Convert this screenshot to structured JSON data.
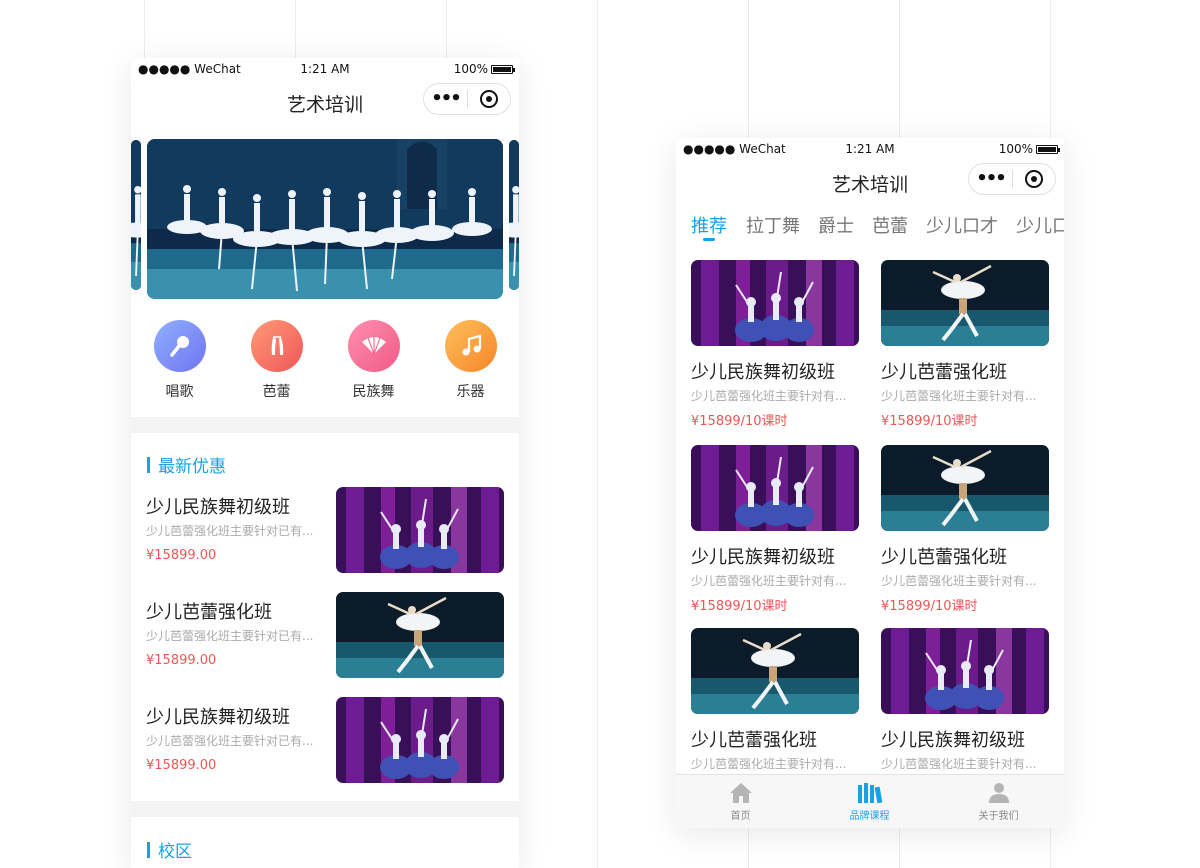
{
  "status_bar": {
    "carrier": "●●●●● WeChat",
    "time": "1:21 AM",
    "battery": "100%"
  },
  "nav": {
    "title": "艺术培训",
    "more_glyph": "•••"
  },
  "left_screen": {
    "categories": [
      {
        "label": "唱歌",
        "icon": "microphone-icon"
      },
      {
        "label": "芭蕾",
        "icon": "ballet-shoes-icon"
      },
      {
        "label": "民族舞",
        "icon": "fan-icon"
      },
      {
        "label": "乐器",
        "icon": "music-note-icon"
      }
    ],
    "promo_section": {
      "title": "最新优惠",
      "items": [
        {
          "title": "少儿民族舞初级班",
          "desc": "少儿芭蕾强化班主要针对已有...",
          "price": "¥15899.00",
          "image": "folk-dance-photo"
        },
        {
          "title": "少儿芭蕾强化班",
          "desc": "少儿芭蕾强化班主要针对已有...",
          "price": "¥15899.00",
          "image": "ballet-duet-photo"
        },
        {
          "title": "少儿民族舞初级班",
          "desc": "少儿芭蕾强化班主要针对已有...",
          "price": "¥15899.00",
          "image": "folk-dance-photo"
        }
      ]
    },
    "campus_section": {
      "title": "校区"
    }
  },
  "right_screen": {
    "tabs": [
      "推荐",
      "拉丁舞",
      "爵士",
      "芭蕾",
      "少儿口才",
      "少儿口"
    ],
    "active_tab": "推荐",
    "courses": [
      {
        "title": "少儿民族舞初级班",
        "desc": "少儿芭蕾强化班主要针对有...",
        "price": "¥15899/10课时",
        "image": "folk-dance-photo"
      },
      {
        "title": "少儿芭蕾强化班",
        "desc": "少儿芭蕾强化班主要针对有...",
        "price": "¥15899/10课时",
        "image": "ballet-duet-photo"
      },
      {
        "title": "少儿民族舞初级班",
        "desc": "少儿芭蕾强化班主要针对有...",
        "price": "¥15899/10课时",
        "image": "folk-dance-photo"
      },
      {
        "title": "少儿芭蕾强化班",
        "desc": "少儿芭蕾强化班主要针对有...",
        "price": "¥15899/10课时",
        "image": "ballet-duet-photo"
      },
      {
        "title": "少儿芭蕾强化班",
        "desc": "少儿芭蕾强化班主要针对有...",
        "price": "",
        "image": "ballet-duet-photo"
      },
      {
        "title": "少儿民族舞初级班",
        "desc": "少儿芭蕾强化班主要针对有...",
        "price": "",
        "image": "folk-dance-photo"
      }
    ],
    "bottom_tabs": [
      {
        "label": "首页",
        "icon": "home-icon"
      },
      {
        "label": "品牌课程",
        "icon": "books-icon"
      },
      {
        "label": "关于我们",
        "icon": "user-icon"
      }
    ],
    "active_bottom_tab": "品牌课程"
  },
  "colors": {
    "accent": "#1aa1e4",
    "price": "#ef5656",
    "background": "#f3f3f3"
  }
}
